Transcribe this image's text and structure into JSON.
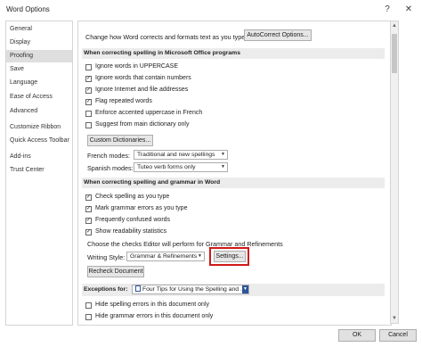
{
  "window": {
    "title": "Word Options",
    "help_glyph": "?",
    "close_glyph": "✕"
  },
  "sidebar": {
    "items": [
      {
        "label": "General",
        "selected": false
      },
      {
        "label": "Display",
        "selected": false
      },
      {
        "label": "Proofing",
        "selected": true
      },
      {
        "label": "Save",
        "selected": false
      },
      {
        "label": "Language",
        "selected": false
      },
      {
        "label": "Ease of Access",
        "selected": false
      },
      {
        "label": "Advanced",
        "selected": false
      },
      {
        "label": "Customize Ribbon",
        "selected": false
      },
      {
        "label": "Quick Access Toolbar",
        "selected": false
      },
      {
        "label": "Add-ins",
        "selected": false
      },
      {
        "label": "Trust Center",
        "selected": false
      }
    ]
  },
  "autocorrect": {
    "text": "Change how Word corrects and formats text as you type:",
    "button": "AutoCorrect Options..."
  },
  "office_section": {
    "title": "When correcting spelling in Microsoft Office programs",
    "checks": [
      {
        "label": "Ignore words in UPPERCASE",
        "checked": false
      },
      {
        "label": "Ignore words that contain numbers",
        "checked": true
      },
      {
        "label": "Ignore Internet and file addresses",
        "checked": true
      },
      {
        "label": "Flag repeated words",
        "checked": true
      },
      {
        "label": "Enforce accented uppercase in French",
        "checked": false
      },
      {
        "label": "Suggest from main dictionary only",
        "checked": false
      }
    ],
    "custom_dict_button": "Custom Dictionaries...",
    "french_modes": {
      "label": "French modes:",
      "value": "Traditional and new spellings"
    },
    "spanish_modes": {
      "label": "Spanish modes:",
      "value": "Tuteo verb forms only"
    }
  },
  "word_section": {
    "title": "When correcting spelling and grammar in Word",
    "checks": [
      {
        "label": "Check spelling as you type",
        "checked": true
      },
      {
        "label": "Mark grammar errors as you type",
        "checked": true
      },
      {
        "label": "Frequently confused words",
        "checked": true
      },
      {
        "label": "Show readability statistics",
        "checked": true
      }
    ],
    "editor_text": "Choose the checks Editor will perform for Grammar and Refinements",
    "writing_style": {
      "label": "Writing Style:",
      "value": "Grammar & Refinements"
    },
    "settings_button": "Settings...",
    "recheck_button": "Recheck Document"
  },
  "exceptions": {
    "label": "Exceptions for:",
    "document": "Four Tips for Using the Spelling and ...",
    "checks": [
      {
        "label": "Hide spelling errors in this document only",
        "checked": false
      },
      {
        "label": "Hide grammar errors in this document only",
        "checked": false
      }
    ]
  },
  "footer": {
    "ok": "OK",
    "cancel": "Cancel"
  },
  "colors": {
    "highlight": "#d01818",
    "selected_bg": "#dedede",
    "section_bg": "#ececec"
  }
}
